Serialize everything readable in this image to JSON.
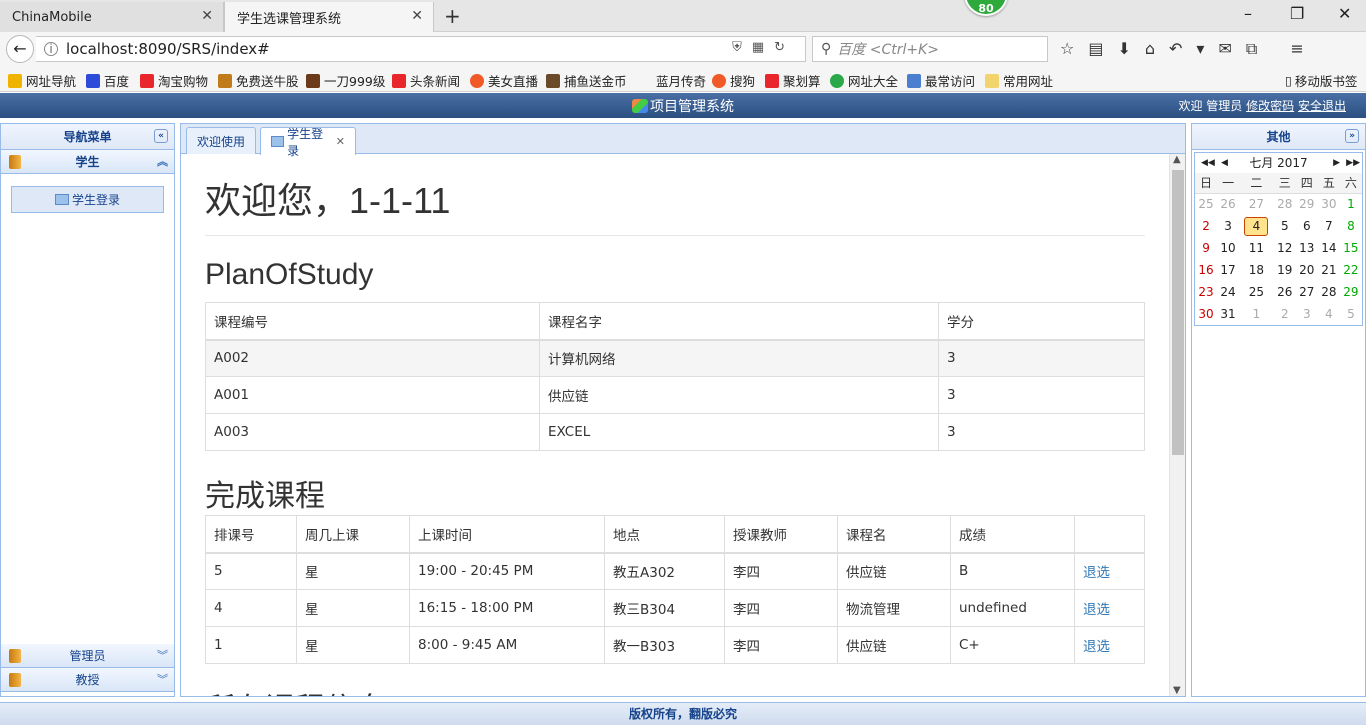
{
  "browser": {
    "tabs": [
      {
        "label": "ChinaMobile"
      },
      {
        "label": "学生选课管理系统"
      }
    ],
    "badge": "80",
    "url": "localhost:8090/SRS/index#",
    "search_placeholder": "百度 <Ctrl+K>",
    "bookmarks": [
      {
        "label": "网址导航",
        "color": "#f0b400"
      },
      {
        "label": "百度",
        "color": "#2b4bd8"
      },
      {
        "label": "淘宝购物",
        "color": "#e8262b"
      },
      {
        "label": "免费送牛股",
        "color": "#c07b1a"
      },
      {
        "label": "一刀999级",
        "color": "#6b3a1a"
      },
      {
        "label": "头条新闻",
        "color": "#e8262b"
      },
      {
        "label": "美女直播",
        "color": "#f05a28"
      },
      {
        "label": "捕鱼送金币",
        "color": "#6b4a2a"
      },
      {
        "label": "蓝月传奇",
        "color": "#ffffff"
      },
      {
        "label": "搜狗",
        "color": "#f05a28"
      },
      {
        "label": "聚划算",
        "color": "#e8262b"
      },
      {
        "label": "网址大全",
        "color": "#2aa84a"
      },
      {
        "label": "最常访问",
        "color": "#4a7fd0"
      },
      {
        "label": "常用网址",
        "color": "#f3d36b"
      }
    ],
    "mobile_bookmarks": "移动版书签"
  },
  "app": {
    "title": "项目管理系统",
    "welcome_user": "欢迎 管理员",
    "change_password": "修改密码",
    "logout": "安全退出",
    "footer": "版权所有，翻版必究"
  },
  "west": {
    "title": "导航菜单",
    "sections": [
      {
        "label": "学生"
      },
      {
        "label": "管理员"
      },
      {
        "label": "教授"
      }
    ],
    "student_items": [
      {
        "label": "学生登录"
      }
    ]
  },
  "center": {
    "tabs": [
      {
        "label": "欢迎使用"
      },
      {
        "label": "学生登录"
      }
    ],
    "welcome": "欢迎您，1-1-11",
    "plan": {
      "title": "PlanOfStudy",
      "headers": [
        "课程编号",
        "课程名字",
        "学分"
      ],
      "rows": [
        [
          "A002",
          "计算机网络",
          "3"
        ],
        [
          "A001",
          "供应链",
          "3"
        ],
        [
          "A003",
          "EXCEL",
          "3"
        ]
      ]
    },
    "completed": {
      "title": "完成课程",
      "headers": [
        "排课号",
        "周几上课",
        "上课时间",
        "地点",
        "授课教师",
        "课程名",
        "成绩",
        ""
      ],
      "rows": [
        [
          "5",
          "星",
          "19:00 - 20:45 PM",
          "教五A302",
          "李四",
          "供应链",
          "B",
          "退选"
        ],
        [
          "4",
          "星",
          "16:15 - 18:00 PM",
          "教三B304",
          "李四",
          "物流管理",
          "undefined",
          "退选"
        ],
        [
          "1",
          "星",
          "8:00 - 9:45 AM",
          "教一B303",
          "李四",
          "供应链",
          "C+",
          "退选"
        ]
      ]
    },
    "all_courses_title": "所有课程信息"
  },
  "east": {
    "title": "其他",
    "calendar": {
      "month_label": "七月 2017",
      "weekdays": [
        "日",
        "一",
        "二",
        "三",
        "四",
        "五",
        "六"
      ],
      "weeks": [
        [
          "25",
          "26",
          "27",
          "28",
          "29",
          "30",
          "1"
        ],
        [
          "2",
          "3",
          "4",
          "5",
          "6",
          "7",
          "8"
        ],
        [
          "9",
          "10",
          "11",
          "12",
          "13",
          "14",
          "15"
        ],
        [
          "16",
          "17",
          "18",
          "19",
          "20",
          "21",
          "22"
        ],
        [
          "23",
          "24",
          "25",
          "26",
          "27",
          "28",
          "29"
        ],
        [
          "30",
          "31",
          "1",
          "2",
          "3",
          "4",
          "5"
        ]
      ],
      "today": "4"
    }
  }
}
